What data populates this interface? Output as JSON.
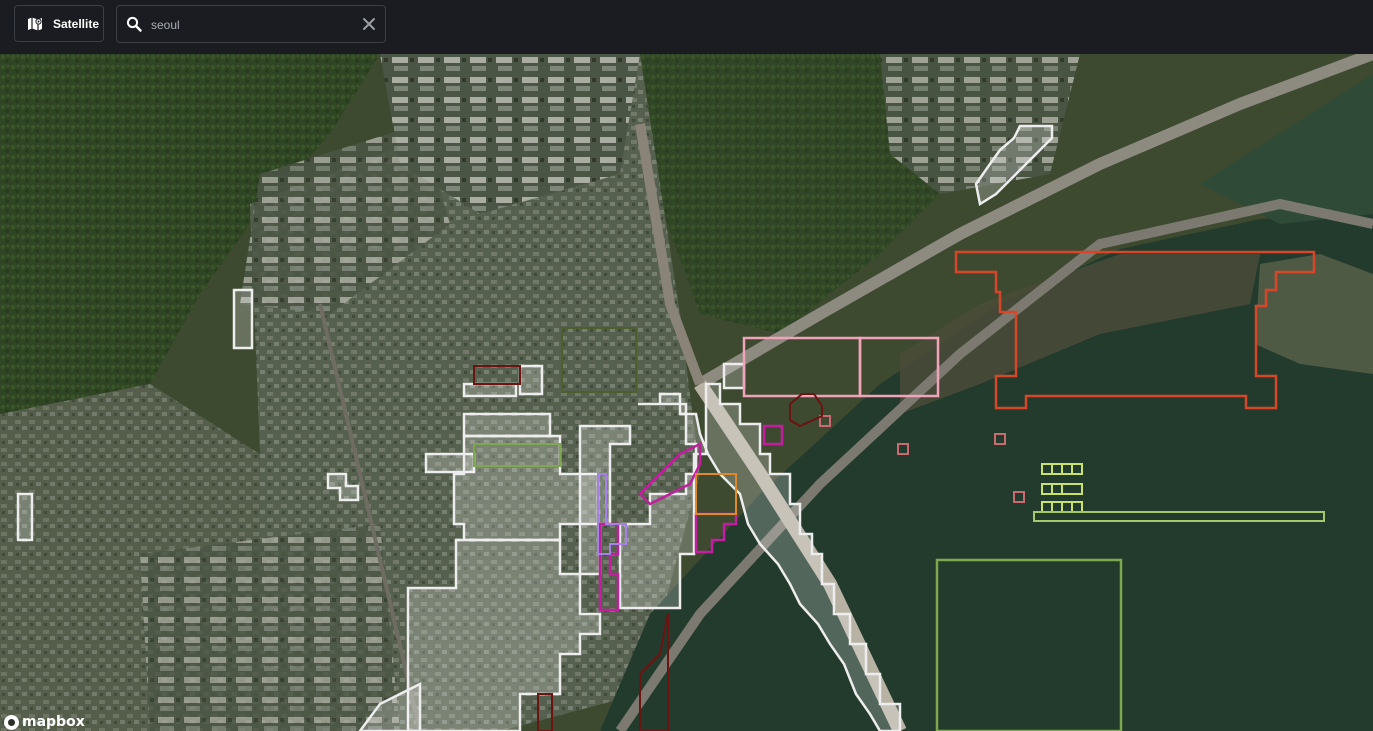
{
  "toolbar": {
    "style_button": {
      "label": "Satellite",
      "icon": "map-icon"
    },
    "search": {
      "value": "seoul",
      "placeholder": "Search",
      "search_icon": "search-icon",
      "clear_icon": "close-icon"
    }
  },
  "map": {
    "basemap": "satellite",
    "attribution": "mapbox",
    "colors": {
      "water": "#233b2d",
      "land": "#3b4a2b",
      "urban": "#5f6659",
      "forest": "#2e4524",
      "road": "#8d8a80",
      "overlay_white": "#e8e8e8",
      "overlay_pink": "#e26b9a",
      "overlay_light_pink": "#f0a3b9",
      "overlay_orange_red": "#d8462a",
      "overlay_orange": "#e0892b",
      "overlay_green": "#7fa74f",
      "overlay_yellow_green": "#c9e26a",
      "overlay_purple": "#a480e8",
      "overlay_magenta": "#c31ea0",
      "overlay_dark_red": "#6b1412",
      "overlay_light_green": "#a6c86c"
    }
  }
}
